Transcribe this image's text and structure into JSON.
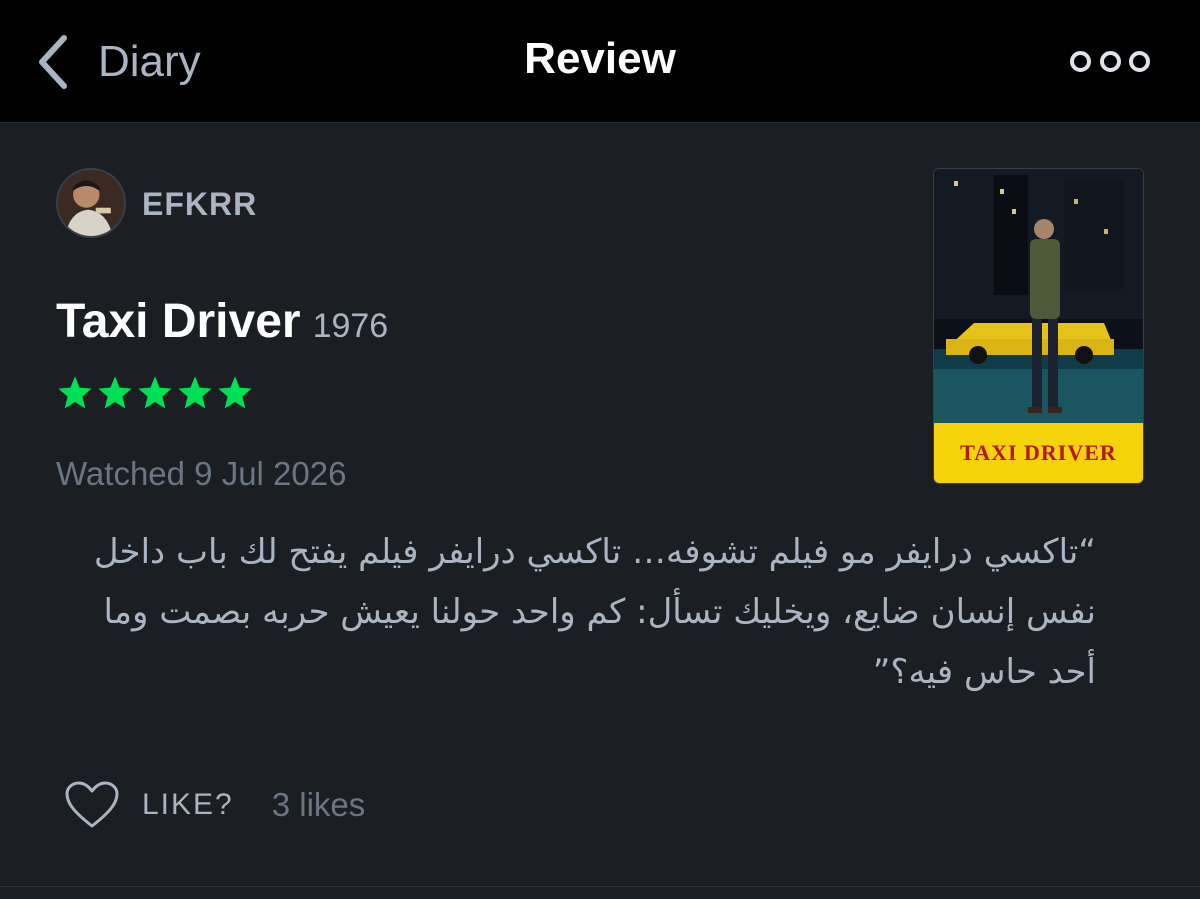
{
  "nav": {
    "back_label": "Diary",
    "title": "Review",
    "more_icon": "ellipsis-icon"
  },
  "review": {
    "username": "EFKRR",
    "film_title": "Taxi Driver",
    "film_year": "1976",
    "rating": 5,
    "watched": "Watched 9 Jul 2026",
    "text": "“تاكسي درايفر مو فيلم تشوفه… تاكسي درايفر فيلم يفتح لك باب داخل نفس إنسان ضايع، ويخليك تسأل: كم واحد حولنا يعيش حربه بصمت وما أحد حاس فيه؟”"
  },
  "poster": {
    "caption": "TAXI DRIVER"
  },
  "actions": {
    "like_label": "LIKE?",
    "likes_count": "3 likes"
  },
  "colors": {
    "background": "#1b1e23",
    "star": "#00e054",
    "secondary_text": "#aab4c2",
    "muted_text": "#6b7685"
  }
}
